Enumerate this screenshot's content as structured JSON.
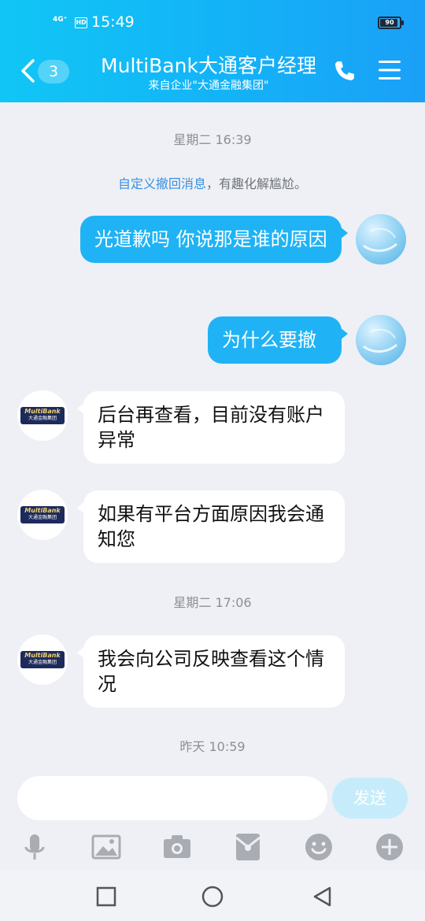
{
  "status_bar": {
    "network": "4G⁺",
    "hd": "HD",
    "time": "15:49",
    "battery_level": "90",
    "battery_fraction": 0.9
  },
  "header": {
    "back_count": "3",
    "title": "MultiBank大通客户经理",
    "subtitle": "来自企业\"大通金融集团\"",
    "icons": [
      "back-chevron-icon",
      "phone-icon",
      "menu-icon"
    ]
  },
  "chat": {
    "timestamps": [
      "星期二 16:39",
      "星期二 17:06",
      "昨天 10:59"
    ],
    "system_notice": {
      "link": "自定义撤回消息",
      "text": "，有趣化解尴尬。"
    },
    "messages": [
      {
        "direction": "out",
        "text": "光道歉吗     你说那是谁的原因"
      },
      {
        "direction": "out",
        "text": "为什么要撤"
      },
      {
        "direction": "in",
        "text": "后台再查看，目前没有账户异常"
      },
      {
        "direction": "in",
        "text": "如果有平台方面原因我会通知您"
      },
      {
        "direction": "in",
        "text": "我会向公司反映查看这个情况"
      }
    ],
    "bank_logo": {
      "line1": "MultiBank",
      "line2": "大通金融集团"
    }
  },
  "input": {
    "value": "",
    "placeholder": "",
    "send_label": "发送"
  },
  "toolbar": {
    "icons": [
      "microphone-icon",
      "image-icon",
      "camera-icon",
      "red-packet-icon",
      "emoji-icon",
      "plus-icon"
    ]
  },
  "nav": {
    "icons": [
      "recent-apps-icon",
      "home-icon",
      "back-icon"
    ]
  },
  "colors": {
    "header_start": "#11c6f6",
    "header_end": "#1aa0f7",
    "bubble_out": "#1fb3f5",
    "bubble_in": "#ffffff",
    "background": "#eef0f5",
    "send_disabled": "#c6ecfb"
  }
}
